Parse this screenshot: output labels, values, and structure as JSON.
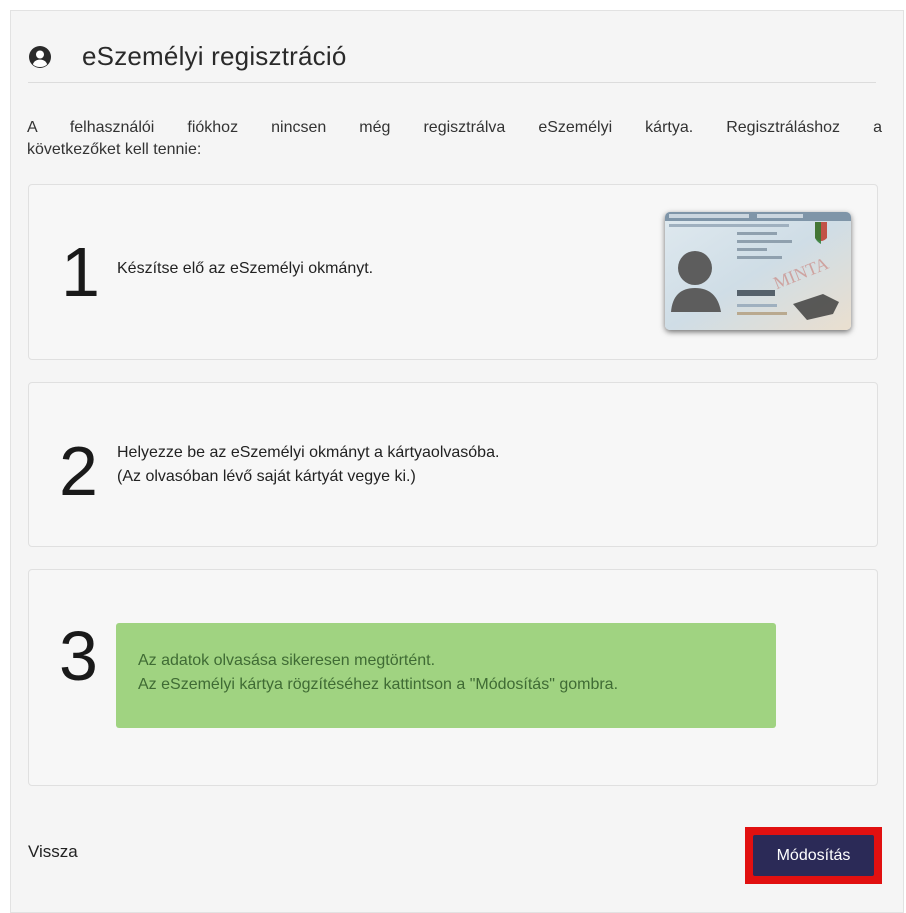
{
  "header": {
    "title": "eSzemélyi regisztráció",
    "icon": "user-circle-icon"
  },
  "intro": {
    "line1": "A felhasználói fiókhoz nincsen még regisztrálva eSzemélyi kártya. Regisztráláshoz a",
    "line2": "következőket kell tennie:"
  },
  "steps": [
    {
      "number": "1",
      "text": "Készítse elő az eSzemélyi okmányt.",
      "image": "id-card-image"
    },
    {
      "number": "2",
      "text_line1": "Helyezze be az eSzemélyi okmányt a kártyaolvasóba.",
      "text_line2": "(Az olvasóban lévő saját kártyát vegye ki.)"
    },
    {
      "number": "3",
      "alert_line1": "Az adatok olvasása sikeresen megtörtént.",
      "alert_line2": "Az eSzemélyi kártya rögzítéséhez kattintson a \"Módosítás\" gombra."
    }
  ],
  "footer": {
    "back_label": "Vissza",
    "submit_label": "Módosítás"
  },
  "colors": {
    "panel_bg": "#f5f5f5",
    "alert_bg": "#a0d381",
    "alert_text": "#3f6b34",
    "button_bg": "#2b2a57",
    "highlight": "#e11010"
  }
}
